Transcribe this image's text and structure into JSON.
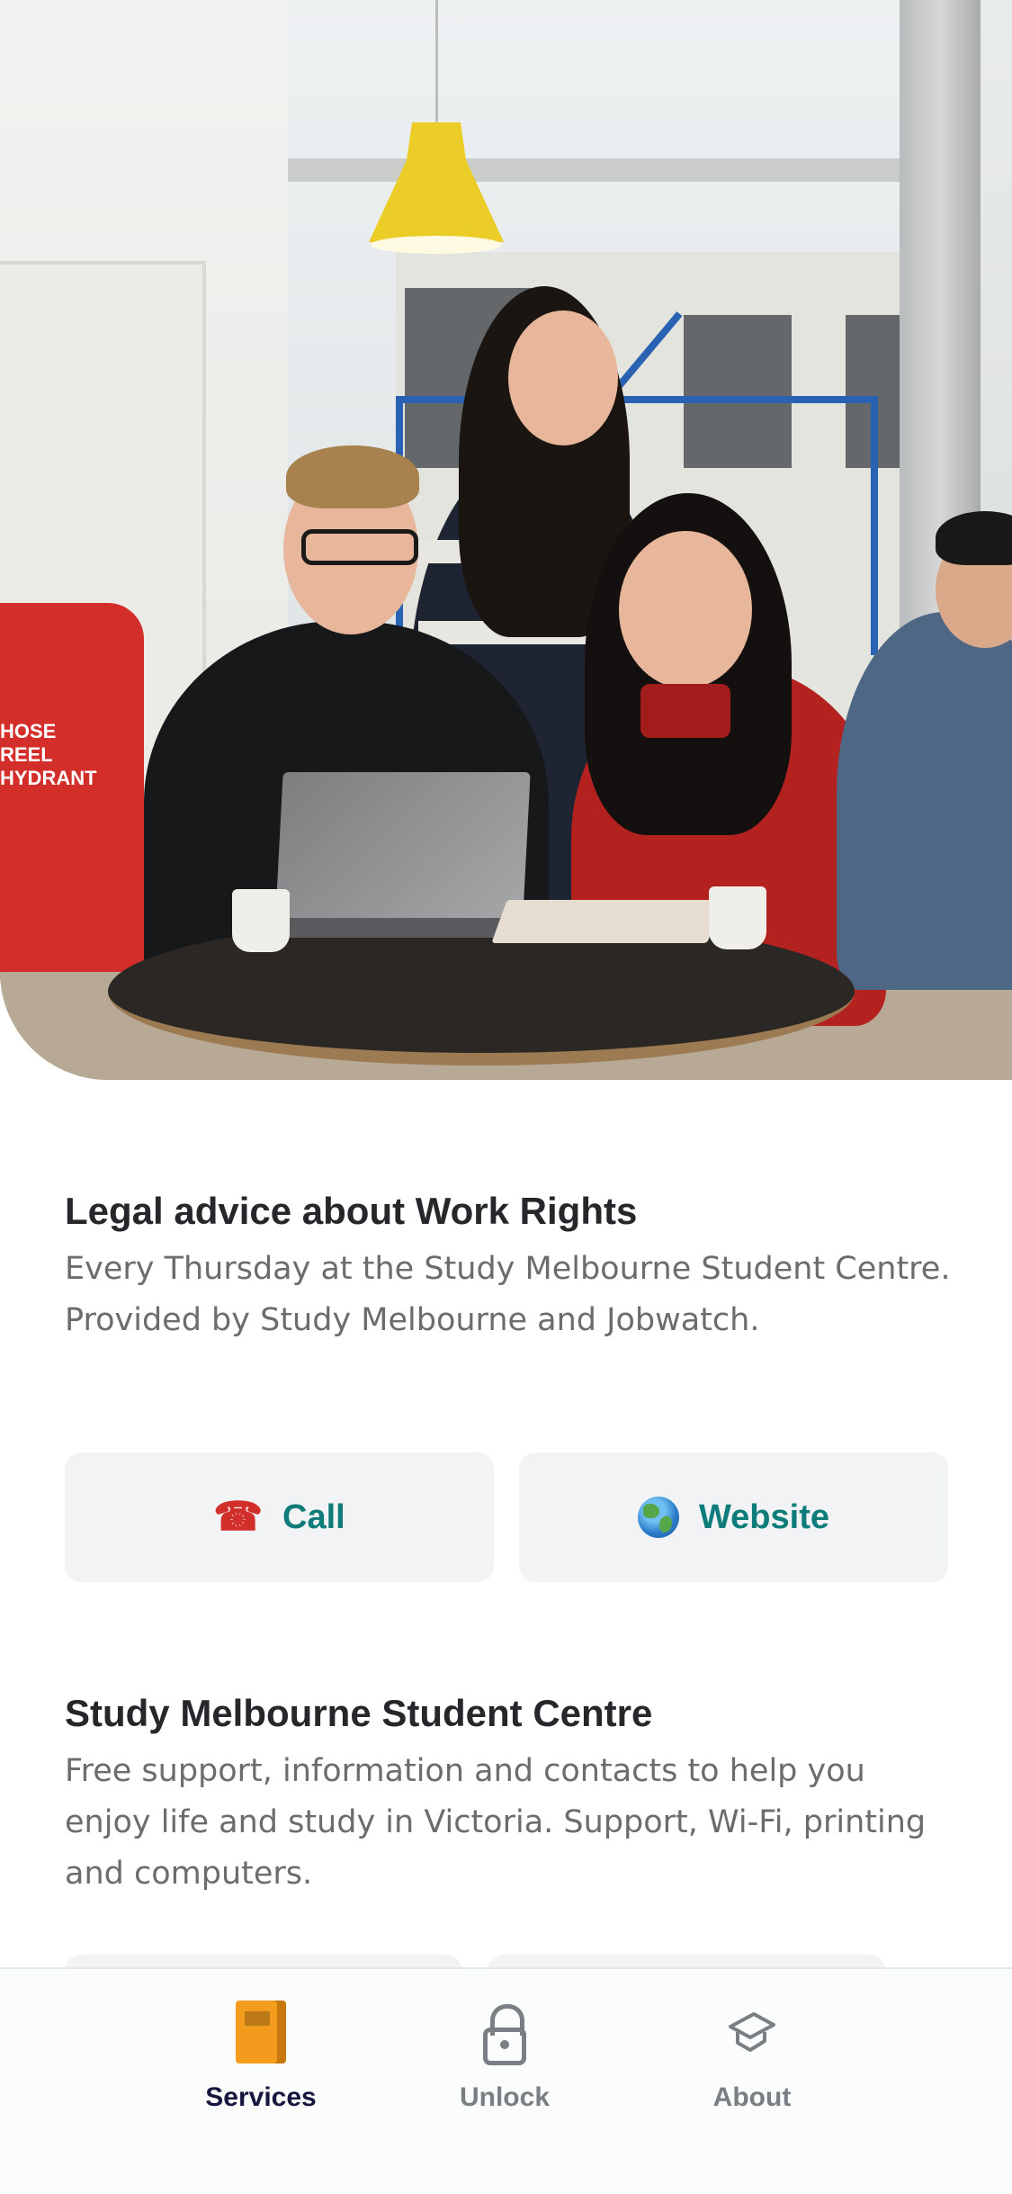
{
  "hero": {
    "hydrant_text": "HOSE REEL\nHYDRANT"
  },
  "services": [
    {
      "title": "Legal advice about Work Rights",
      "description": "Every Thursday at the Study Melbourne Student Centre. Provided by Study Melbourne and Jobwatch.",
      "buttons": [
        {
          "icon": "telephone-icon",
          "label": "Call"
        },
        {
          "icon": "globe-icon",
          "label": "Website"
        }
      ]
    },
    {
      "title": "Study Melbourne Student Centre",
      "description": "Free support, information and contacts to help you enjoy life and study in Victoria. Support, Wi-Fi, printing and computers."
    }
  ],
  "tabbar": {
    "items": [
      {
        "label": "Services",
        "icon": "book-icon",
        "active": true
      },
      {
        "label": "Unlock",
        "icon": "lock-icon",
        "active": false
      },
      {
        "label": "About",
        "icon": "graduation-cap-icon",
        "active": false
      }
    ]
  },
  "colors": {
    "accent_text": "#0d7c7a",
    "active_tab": "#16163f",
    "inactive_tab": "#7a7f83",
    "button_bg": "#f1f3f4"
  }
}
